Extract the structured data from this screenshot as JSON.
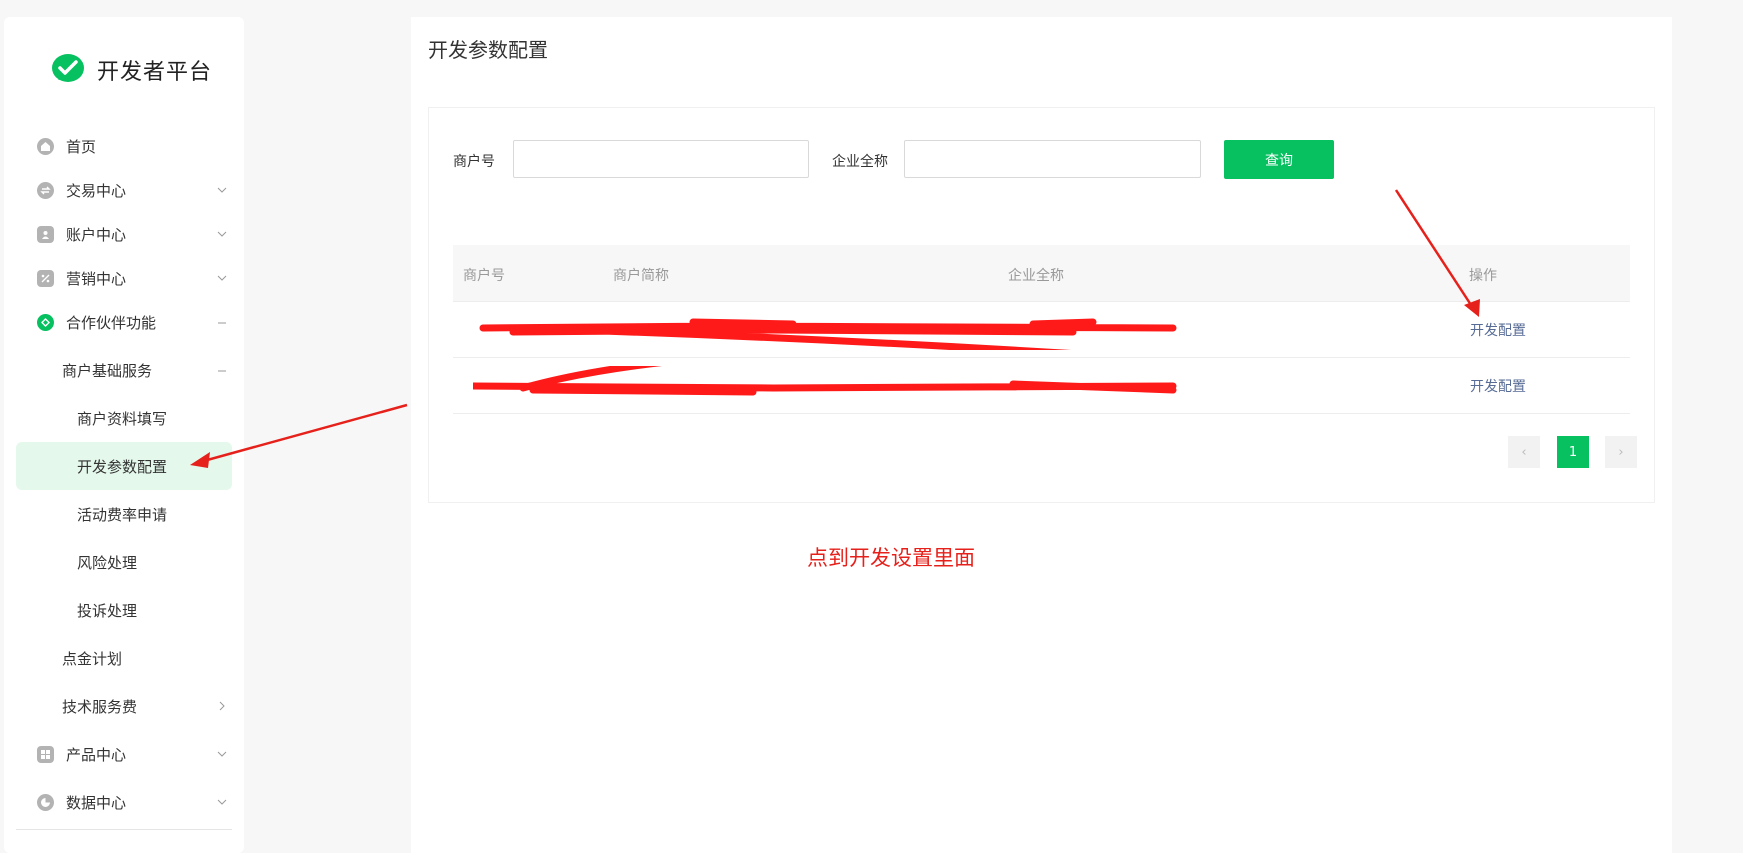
{
  "brand": {
    "name": "开发者平台"
  },
  "sidebar": {
    "items": [
      {
        "label": "首页",
        "icon": "home-icon"
      },
      {
        "label": "交易中心",
        "icon": "exchange-icon"
      },
      {
        "label": "账户中心",
        "icon": "account-icon"
      },
      {
        "label": "营销中心",
        "icon": "percent-icon"
      },
      {
        "label": "合作伙伴功能",
        "icon": "partner-icon"
      },
      {
        "label": "商户基础服务"
      },
      {
        "label": "商户资料填写"
      },
      {
        "label": "开发参数配置"
      },
      {
        "label": "活动费率申请"
      },
      {
        "label": "风险处理"
      },
      {
        "label": "投诉处理"
      },
      {
        "label": "点金计划"
      },
      {
        "label": "技术服务费"
      },
      {
        "label": "产品中心",
        "icon": "grid-icon"
      },
      {
        "label": "数据中心",
        "icon": "pie-chart-icon"
      }
    ],
    "selected": "开发参数配置"
  },
  "main": {
    "title": "开发参数配置",
    "filters": {
      "merchant_id_label": "商户号",
      "merchant_id_value": "",
      "company_name_label": "企业全称",
      "company_name_value": ""
    },
    "query_button": "查询",
    "table": {
      "columns": [
        "商户号",
        "商户简称",
        "企业全称",
        "操作"
      ],
      "rows": [
        {
          "action": "开发配置"
        },
        {
          "action": "开发配置"
        }
      ]
    },
    "pagination": {
      "prev": "‹",
      "current": "1",
      "next": "›"
    }
  },
  "annotation": {
    "note": "点到开发设置里面",
    "color": "#e6211b"
  },
  "colors": {
    "accent": "#07c160",
    "link": "#576b95",
    "annotation": "#e6211b"
  }
}
